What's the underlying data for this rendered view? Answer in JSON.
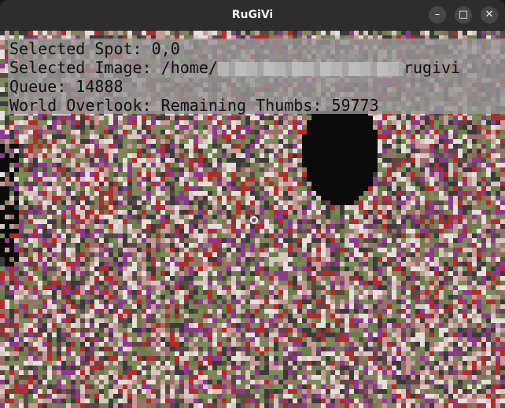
{
  "window": {
    "title": "RuGiVi",
    "controls": {
      "minimize_glyph": "–",
      "maximize_glyph": "□",
      "close_glyph": "✕"
    }
  },
  "overlay": {
    "selected_spot_label": "Selected Spot: ",
    "selected_spot_value": "0,0",
    "selected_image_label": "Selected Image: ",
    "selected_image_prefix": "/home/",
    "selected_image_suffix": "rugivi",
    "queue_label": "Queue: ",
    "queue_value": "14888",
    "overlook_label": "World Overlook: Remaining Thumbs: ",
    "overlook_value": "59773"
  },
  "colors": {
    "titlebar": "#2d2d2d",
    "background": "#0b0b0b",
    "overlay": "#969696",
    "mosaic_palette": [
      "#8b3a8f",
      "#b52a2a",
      "#7a8b5a",
      "#c89a9a",
      "#5c4646",
      "#d6c7c0",
      "#3a3a3a",
      "#9a6f6a",
      "#e6e0dc",
      "#6b7d4b"
    ]
  }
}
